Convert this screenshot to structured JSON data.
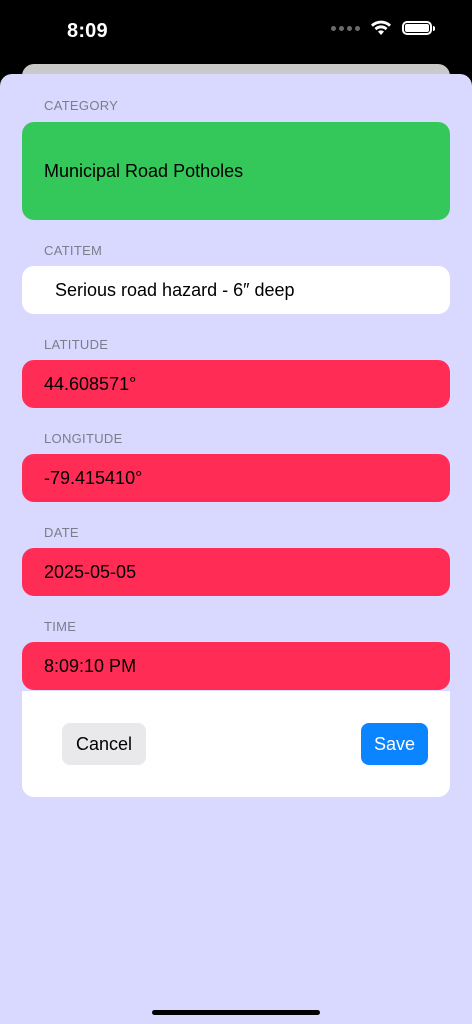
{
  "status_bar": {
    "time": "8:09"
  },
  "form": {
    "category": {
      "label": "CATEGORY",
      "value": "Municipal Road Potholes"
    },
    "catitem": {
      "label": "CATITEM",
      "value": "Serious road hazard - 6″ deep"
    },
    "latitude": {
      "label": "LATITUDE",
      "value": "44.608571°"
    },
    "longitude": {
      "label": "LONGITUDE",
      "value": "-79.415410°"
    },
    "date": {
      "label": "DATE",
      "value": "2025-05-05"
    },
    "time": {
      "label": "TIME",
      "value": "8:09:10 PM"
    }
  },
  "actions": {
    "cancel_label": "Cancel",
    "save_label": "Save"
  },
  "colors": {
    "sheet_background": "#d9d8ff",
    "category_field": "#34c759",
    "readonly_field": "#ff2d55",
    "save_button": "#0a84ff"
  },
  "icons": [
    "signal-dots-icon",
    "wifi-icon",
    "battery-icon"
  ]
}
